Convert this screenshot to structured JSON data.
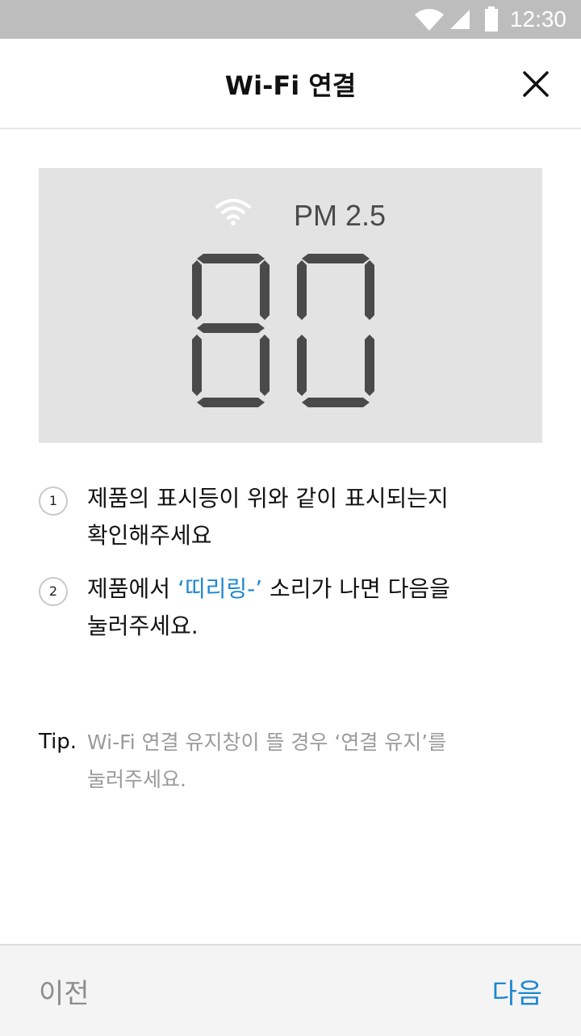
{
  "status_bar": {
    "time": "12:30",
    "icons": [
      "wifi-icon",
      "signal-icon",
      "battery-icon"
    ]
  },
  "header": {
    "title": "Wi-Fi 연결",
    "close_icon": "close-icon"
  },
  "display": {
    "label": "PM 2.5",
    "digits": "80",
    "icons": [
      "wifi-icon"
    ]
  },
  "steps": [
    {
      "number": "1",
      "line1": "제품의 표시등이 위와 같이 표시되는지",
      "line2": "확인해주세요"
    },
    {
      "number": "2",
      "prefix": "제품에서 ",
      "highlight": "‘띠리링-’",
      "suffix": " 소리가 나면 다음을",
      "line2": "눌러주세요."
    }
  ],
  "tip": {
    "label": "Tip.",
    "line1": "Wi-Fi 연결 유지창이 뜰 경우 ‘연결 유지’를",
    "line2": "눌러주세요."
  },
  "footer": {
    "prev_label": "이전",
    "next_label": "다음"
  },
  "colors": {
    "accent": "#1e88d0",
    "status_bar": "#bdbdbd",
    "display_bg": "#e3e3e3",
    "segment": "#4a4a4a"
  }
}
